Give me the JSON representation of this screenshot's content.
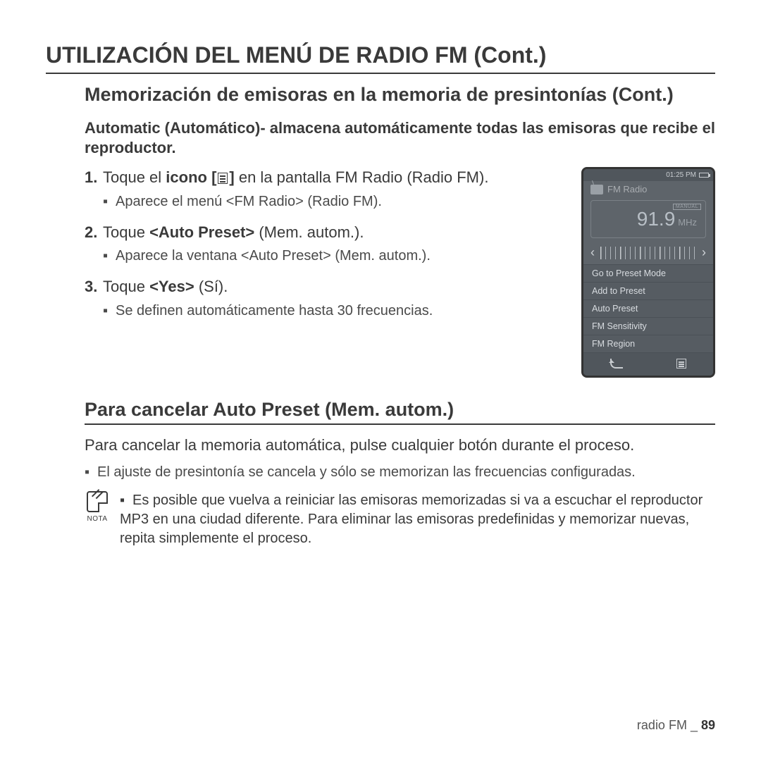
{
  "title": "UTILIZACIÓN DEL MENÚ DE RADIO FM (Cont.)",
  "subheading": "Memorización de emisoras en la memoria de presintonías (Cont.)",
  "intro": "Automatic (Automático)-  almacena automáticamente todas las emisoras que recibe el reproductor.",
  "steps": [
    {
      "num": "1.",
      "pre": "Toque el ",
      "bold1": "icono [",
      "bold2": "]",
      "post": " en la pantalla FM Radio (Radio FM).",
      "sub": "Aparece el menú <FM Radio> (Radio FM)."
    },
    {
      "num": "2.",
      "pre": "Toque ",
      "bold1": "<Auto Preset>",
      "post": " (Mem. autom.).",
      "sub": "Aparece la ventana <Auto Preset> (Mem. autom.)."
    },
    {
      "num": "3.",
      "pre": "Toque ",
      "bold1": "<Yes>",
      "post": " (Sí).",
      "sub": "Se deﬁnen automáticamente hasta 30 frecuencias."
    }
  ],
  "device": {
    "time": "01:25 PM",
    "app": "FM Radio",
    "mode": "MANUAL",
    "freq": "91.9",
    "unit": "MHz",
    "menu": [
      "Go to Preset Mode",
      "Add to Preset",
      "Auto Preset",
      "FM Sensitivity",
      "FM Region"
    ]
  },
  "cancel_heading": "Para cancelar Auto Preset (Mem. autom.)",
  "cancel_para": "Para cancelar la memoria automática, pulse cualquier botón durante el proceso.",
  "cancel_sub": "El ajuste de presintonía se cancela y sólo se memorizan las frecuencias conﬁguradas.",
  "nota_label": "NOTA",
  "nota_text": "Es posible que vuelva a reiniciar las emisoras memorizadas si va a escuchar el reproductor MP3 en una ciudad diferente. Para eliminar las emisoras predeﬁnidas y memorizar nuevas, repita simplemente el proceso.",
  "footer_section": "radio FM _",
  "footer_page": "89"
}
